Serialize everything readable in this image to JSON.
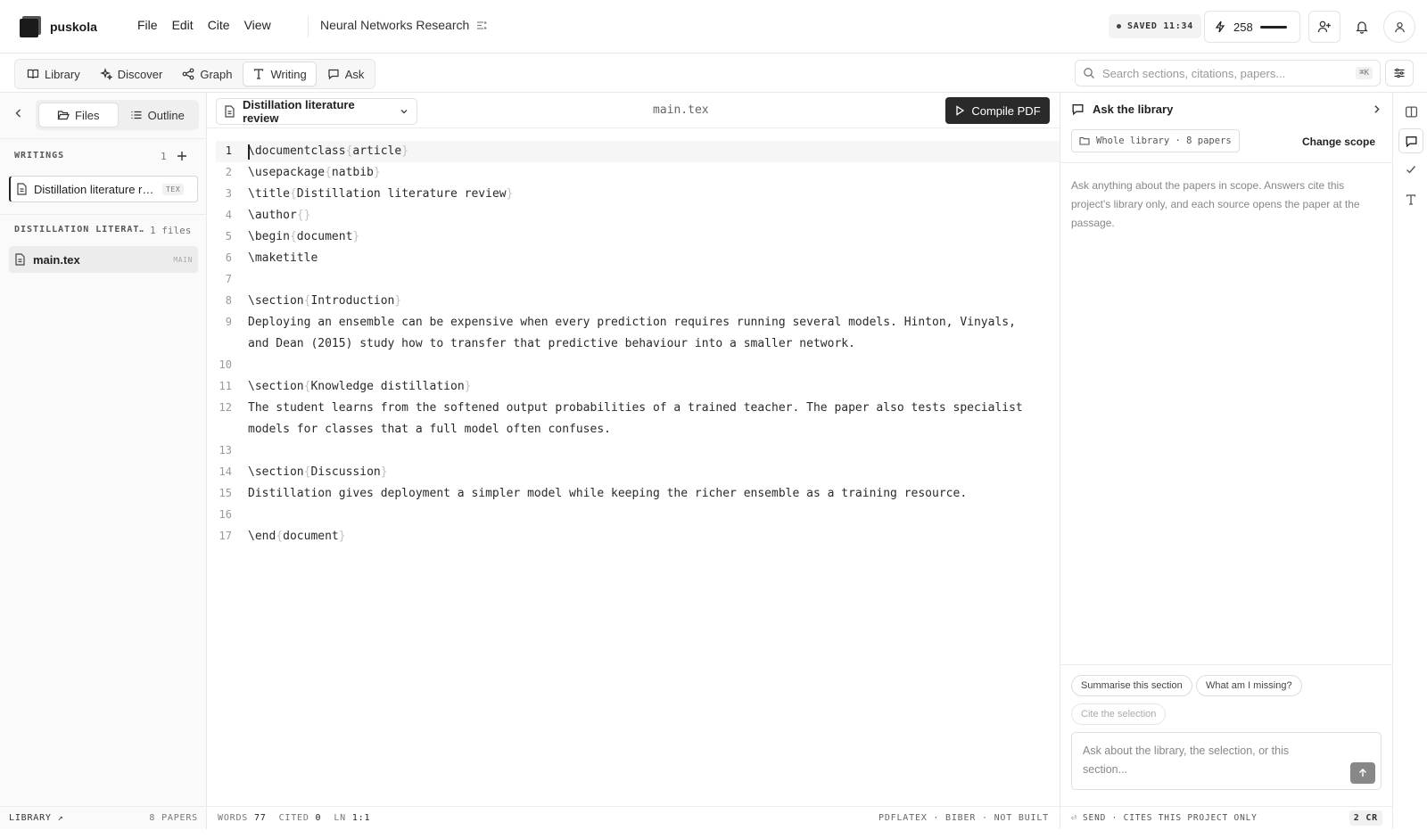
{
  "app": {
    "name": "puskola"
  },
  "menu": [
    "File",
    "Edit",
    "Cite",
    "View"
  ],
  "project": {
    "name": "Neural Networks Research"
  },
  "status": {
    "saved": "SAVED 11:34",
    "credits": "258"
  },
  "nav": {
    "tabs": [
      {
        "label": "Library",
        "icon": "book-icon"
      },
      {
        "label": "Discover",
        "icon": "sparkle-icon"
      },
      {
        "label": "Graph",
        "icon": "graph-icon"
      },
      {
        "label": "Writing",
        "icon": "text-icon"
      },
      {
        "label": "Ask",
        "icon": "chat-icon"
      }
    ],
    "active": "Writing",
    "search_placeholder": "Search sections, citations, papers...",
    "search_shortcut": "⌘K"
  },
  "sidebar": {
    "tabs": [
      "Files",
      "Outline"
    ],
    "writings_label": "WRITINGS",
    "writings_count": "1",
    "writing_item": {
      "title": "Distillation literature review",
      "tag": "TEX"
    },
    "folder_label": "DISTILLATION LITERAT…",
    "folder_count": "1 files",
    "file": {
      "name": "main.tex",
      "tag": "MAIN"
    },
    "footer_left": "LIBRARY ↗",
    "footer_right": "8 PAPERS"
  },
  "editor": {
    "doc_title": "Distillation literature review",
    "filename": "main.tex",
    "compile_label": "Compile PDF",
    "lines": [
      {
        "n": "1",
        "parts": [
          [
            "\\documentclass",
            "c"
          ],
          [
            "{",
            "b"
          ],
          [
            "article",
            "c"
          ],
          [
            "}",
            "b"
          ]
        ]
      },
      {
        "n": "2",
        "parts": [
          [
            "\\usepackage",
            "c"
          ],
          [
            "{",
            "b"
          ],
          [
            "natbib",
            "c"
          ],
          [
            "}",
            "b"
          ]
        ]
      },
      {
        "n": "3",
        "parts": [
          [
            "\\title",
            "c"
          ],
          [
            "{",
            "b"
          ],
          [
            "Distillation literature review",
            "c"
          ],
          [
            "}",
            "b"
          ]
        ]
      },
      {
        "n": "4",
        "parts": [
          [
            "\\author",
            "c"
          ],
          [
            "{}",
            "b"
          ]
        ]
      },
      {
        "n": "5",
        "parts": [
          [
            "\\begin",
            "c"
          ],
          [
            "{",
            "b"
          ],
          [
            "document",
            "c"
          ],
          [
            "}",
            "b"
          ]
        ]
      },
      {
        "n": "6",
        "parts": [
          [
            "\\maketitle",
            "c"
          ]
        ]
      },
      {
        "n": "7",
        "parts": []
      },
      {
        "n": "8",
        "parts": [
          [
            "\\section",
            "c"
          ],
          [
            "{",
            "b"
          ],
          [
            "Introduction",
            "c"
          ],
          [
            "}",
            "b"
          ]
        ]
      },
      {
        "n": "9",
        "parts": [
          [
            "Deploying an ensemble can be expensive when every prediction requires running several models. Hinton, Vinyals, and Dean (2015) study how to transfer that predictive behaviour into a smaller network.",
            "c"
          ]
        ]
      },
      {
        "n": "10",
        "parts": []
      },
      {
        "n": "11",
        "parts": [
          [
            "\\section",
            "c"
          ],
          [
            "{",
            "b"
          ],
          [
            "Knowledge distillation",
            "c"
          ],
          [
            "}",
            "b"
          ]
        ]
      },
      {
        "n": "12",
        "parts": [
          [
            "The student learns from the softened output probabilities of a trained teacher. The paper also tests specialist models for classes that a full model often confuses.",
            "c"
          ]
        ]
      },
      {
        "n": "13",
        "parts": []
      },
      {
        "n": "14",
        "parts": [
          [
            "\\section",
            "c"
          ],
          [
            "{",
            "b"
          ],
          [
            "Discussion",
            "c"
          ],
          [
            "}",
            "b"
          ]
        ]
      },
      {
        "n": "15",
        "parts": [
          [
            "Distillation gives deployment a simpler model while keeping the richer ensemble as a training resource.",
            "c"
          ]
        ]
      },
      {
        "n": "16",
        "parts": []
      },
      {
        "n": "17",
        "parts": [
          [
            "\\end",
            "c"
          ],
          [
            "{",
            "b"
          ],
          [
            "document",
            "c"
          ],
          [
            "}",
            "b"
          ]
        ]
      }
    ],
    "footer": {
      "words_label": "WORDS",
      "words": "77",
      "cited_label": "CITED",
      "cited": "0",
      "ln_label": "LN",
      "ln": "1:1",
      "build": "PDFLATEX · BIBER · NOT BUILT"
    }
  },
  "ask": {
    "title": "Ask the library",
    "scope": "Whole library · 8 papers",
    "change_scope": "Change scope",
    "info": "Ask anything about the papers in scope. Answers cite this project's library only, and each source opens the paper at the passage.",
    "chips": [
      "Summarise this section",
      "What am I missing?",
      "Cite the selection"
    ],
    "input_placeholder": "Ask about the library, the selection, or this section...",
    "footer": "⏎ SEND · CITES THIS PROJECT ONLY",
    "credit_cost": "2 CR"
  }
}
